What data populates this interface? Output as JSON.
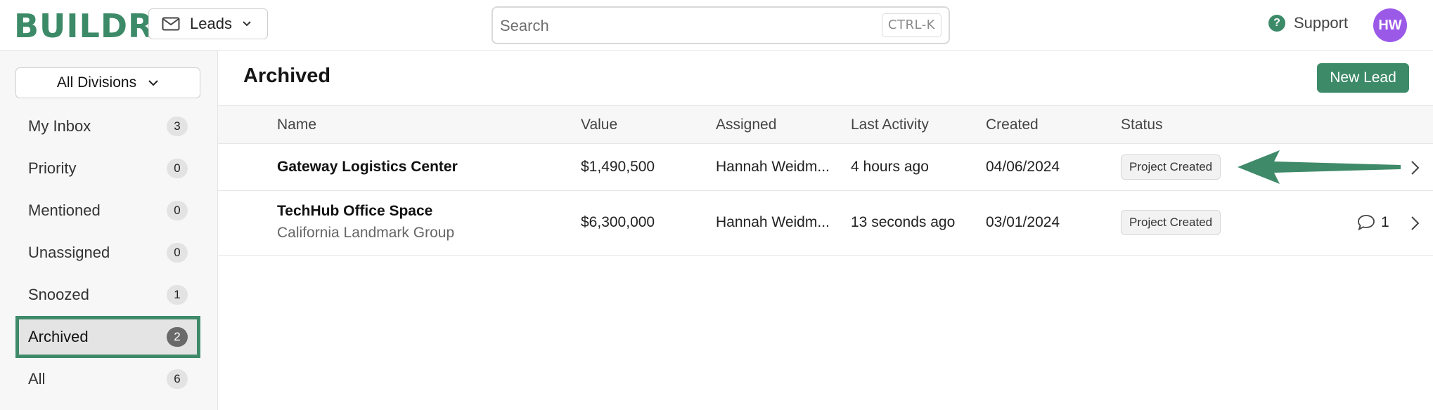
{
  "header": {
    "logo": "BUILDR",
    "module": "Leads",
    "search_placeholder": "Search",
    "search_shortcut": "CTRL-K",
    "support_label": "Support",
    "avatar_initials": "HW"
  },
  "sidebar": {
    "division_select": "All Divisions",
    "items": [
      {
        "label": "My Inbox",
        "count": "3"
      },
      {
        "label": "Priority",
        "count": "0"
      },
      {
        "label": "Mentioned",
        "count": "0"
      },
      {
        "label": "Unassigned",
        "count": "0"
      },
      {
        "label": "Snoozed",
        "count": "1"
      },
      {
        "label": "Archived",
        "count": "2",
        "active": true
      },
      {
        "label": "All",
        "count": "6"
      }
    ]
  },
  "main": {
    "title": "Archived",
    "new_lead_label": "New Lead",
    "columns": [
      "Name",
      "Value",
      "Assigned",
      "Last Activity",
      "Created",
      "Status"
    ],
    "rows": [
      {
        "name": "Gateway Logistics Center",
        "company": "",
        "value": "$1,490,500",
        "assigned": "Hannah Weidm...",
        "last_activity": "4 hours ago",
        "created": "04/06/2024",
        "status": "Project Created",
        "comments": ""
      },
      {
        "name": "TechHub Office Space",
        "company": "California Landmark Group",
        "value": "$6,300,000",
        "assigned": "Hannah Weidm...",
        "last_activity": "13 seconds ago",
        "created": "03/01/2024",
        "status": "Project Created",
        "comments": "1"
      }
    ]
  },
  "colors": {
    "brand": "#3c8a68",
    "avatar": "#9b59e8",
    "annotation_arrow": "#3f8a69"
  },
  "icons": {
    "module": "mail-icon",
    "support": "help-circle-icon",
    "row_open": "chevron-right-icon",
    "comments": "comment-icon"
  }
}
